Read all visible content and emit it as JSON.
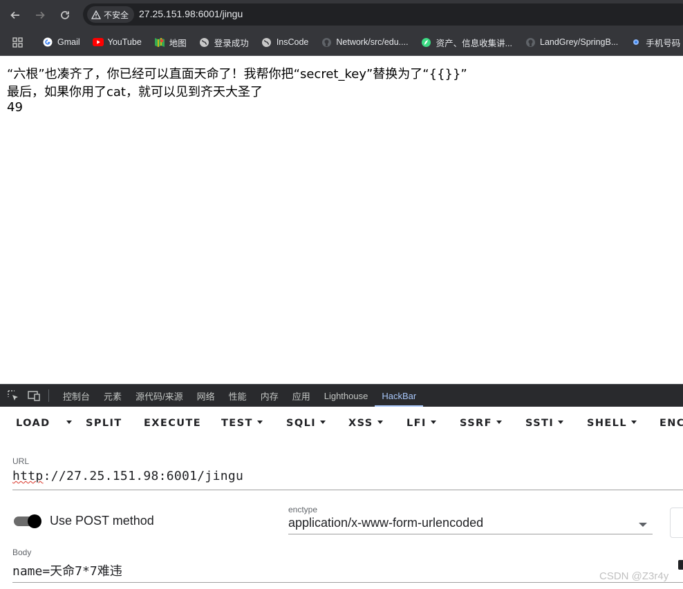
{
  "browser": {
    "security_label": "不安全",
    "url": "27.25.151.98:6001/jingu",
    "bookmarks": [
      {
        "label": "Gmail",
        "icon": "google-icon"
      },
      {
        "label": "YouTube",
        "icon": "youtube-icon"
      },
      {
        "label": "地图",
        "icon": "maps-icon"
      },
      {
        "label": "登录成功",
        "icon": "globe-icon"
      },
      {
        "label": "InsCode",
        "icon": "globe-icon"
      },
      {
        "label": "Network/src/edu....",
        "icon": "github-icon"
      },
      {
        "label": "资产、信息收集讲...",
        "icon": "leaf-icon"
      },
      {
        "label": "LandGrey/SpringB...",
        "icon": "github-icon"
      },
      {
        "label": "手机号码",
        "icon": "dot-icon"
      }
    ]
  },
  "page": {
    "lines": [
      "“六根”也凑齐了，你已经可以直面天命了！我帮你把“secret_key”替换为了“{{}}”",
      "最后，如果你用了cat，就可以见到齐天大圣了",
      "49"
    ]
  },
  "devtools": {
    "tabs": [
      "控制台",
      "元素",
      "源代码/来源",
      "网络",
      "性能",
      "内存",
      "应用",
      "Lighthouse",
      "HackBar"
    ],
    "active_tab": "HackBar"
  },
  "hackbar": {
    "load_label": "LOAD",
    "split_label": "SPLIT",
    "execute_label": "EXECUTE",
    "test_label": "TEST",
    "sqli_label": "SQLI",
    "xss_label": "XSS",
    "lfi_label": "LFI",
    "ssrf_label": "SSRF",
    "ssti_label": "SSTI",
    "shell_label": "SHELL",
    "enc_label": "ENC",
    "url_label": "URL",
    "url_scheme": "http",
    "url_rest": "://27.25.151.98:6001/jingu",
    "post_toggle_label": "Use POST method",
    "post_enabled": true,
    "enctype_label": "enctype",
    "enctype_value": "application/x-www-form-urlencoded",
    "body_label": "Body",
    "body_value": "name=天命7*7难违"
  },
  "watermark": "CSDN @Z3r4y"
}
